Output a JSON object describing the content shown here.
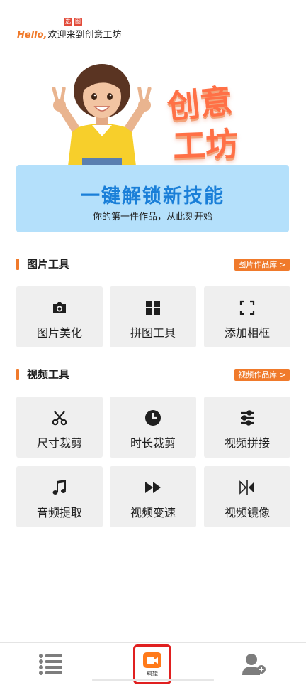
{
  "header": {
    "logo_chars": [
      "选",
      "图"
    ],
    "hello": "Hello,",
    "welcome": "欢迎来到创意工坊"
  },
  "hero": {
    "title_line1": "创意",
    "title_line2": "工坊"
  },
  "banner": {
    "title": "一键解锁新技能",
    "subtitle": "你的第一件作品，从此刻开始"
  },
  "image_tools": {
    "title": "图片工具",
    "link": "图片作品库 >",
    "items": [
      {
        "label": "图片美化",
        "icon": "camera-icon"
      },
      {
        "label": "拼图工具",
        "icon": "grid-icon"
      },
      {
        "label": "添加相框",
        "icon": "frame-corners-icon"
      }
    ]
  },
  "video_tools": {
    "title": "视频工具",
    "link": "视频作品库 >",
    "items": [
      {
        "label": "尺寸裁剪",
        "icon": "scissors-icon"
      },
      {
        "label": "时长裁剪",
        "icon": "clock-icon"
      },
      {
        "label": "视频拼接",
        "icon": "sliders-icon"
      },
      {
        "label": "音频提取",
        "icon": "music-note-icon"
      },
      {
        "label": "视频变速",
        "icon": "fast-forward-icon"
      },
      {
        "label": "视频镜像",
        "icon": "mirror-icon"
      }
    ]
  },
  "bottom_nav": {
    "center_label": "剪辑"
  },
  "colors": {
    "accent": "#f07a2b",
    "banner_bg": "#b4e0fb",
    "banner_title": "#1a7fd8",
    "card_bg": "#efefef",
    "highlight_border": "#e02020"
  }
}
